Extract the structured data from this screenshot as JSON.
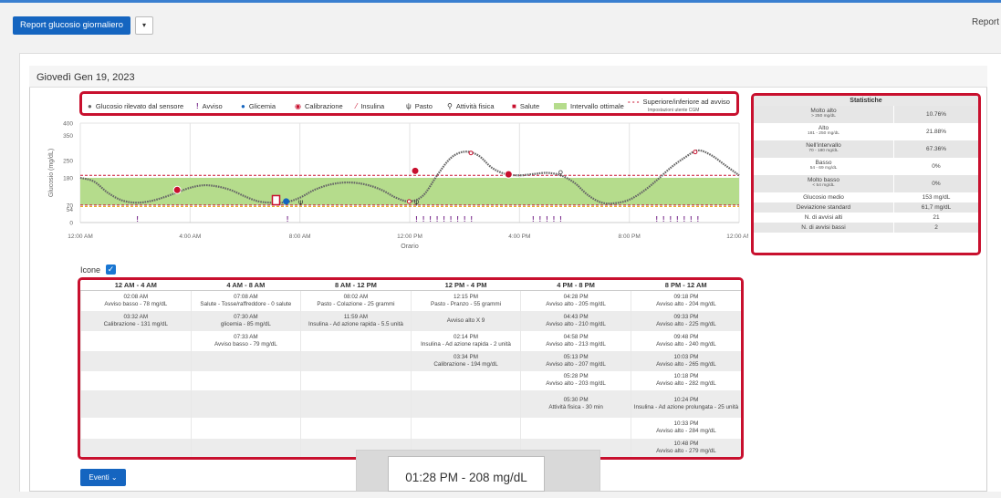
{
  "header": {
    "report_button": "Report glucosio giornaliero",
    "dropdown_caret": "▾",
    "report_right": "Report"
  },
  "date_title": "Giovedì Gen 19, 2023",
  "legend": {
    "sensor": "Glucosio rilevato dal sensore",
    "alert": "Avviso",
    "bg": "Glicemia",
    "calibration": "Calibrazione",
    "insulin": "Insulina",
    "meal": "Pasto",
    "exercise": "Attività fisica",
    "health": "Salute",
    "range": "Intervallo ottimale",
    "limits": "Superiore/inferiore ad avviso",
    "limits_sub": "Impostazioni utente CGM"
  },
  "colors": {
    "range_fill": "#b5dc8c",
    "limit_line": "#c8102e",
    "alert": "#7a2c8c",
    "highlight_border": "#c8102e",
    "primary": "#1565c0"
  },
  "stats": {
    "title": "Statistiche",
    "rows": [
      {
        "label": "Molto alto",
        "sub": "> 250 mg/dL",
        "value": "10.76%"
      },
      {
        "label": "Alto",
        "sub": "181 - 250 mg/dL",
        "value": "21.88%"
      },
      {
        "label": "Nell'intervallo",
        "sub": "70 - 180 mg/dL",
        "value": "67.36%"
      },
      {
        "label": "Basso",
        "sub": "54 - 69 mg/dL",
        "value": "0%"
      },
      {
        "label": "Molto basso",
        "sub": "< 54 mg/dL",
        "value": "0%"
      },
      {
        "label": "Glucosio medio",
        "sub": "",
        "value": "153 mg/dL"
      },
      {
        "label": "Deviazione standard",
        "sub": "",
        "value": "61,7 mg/dL"
      },
      {
        "label": "N. di avvisi alti",
        "sub": "",
        "value": "21"
      },
      {
        "label": "N. di avvisi bassi",
        "sub": "",
        "value": "2"
      }
    ]
  },
  "chart_data": {
    "type": "line",
    "ylabel": "Glucosio (mg/dL)",
    "xlabel": "Orario",
    "ylim": [
      0,
      400
    ],
    "yticks": [
      0,
      54,
      70,
      180,
      250,
      350,
      400
    ],
    "xticks": [
      "12:00 AM",
      "4:00 AM",
      "8:00 AM",
      "12:00 PM",
      "4:00 PM",
      "8:00 PM",
      "12:00 AM"
    ],
    "target_range": [
      70,
      180
    ],
    "alert_limits": [
      70,
      190
    ],
    "series": [
      {
        "x": [
          0,
          0.5,
          1,
          1.5,
          2,
          2.5,
          3,
          3.5,
          4,
          4.5,
          5,
          5.5,
          6,
          6.5,
          7,
          7.5,
          8,
          8.5,
          9,
          9.5,
          10,
          10.5,
          11,
          11.5,
          12,
          12.5,
          13,
          13.5,
          14,
          14.5,
          15,
          15.5,
          16,
          16.5,
          17,
          17.5,
          18,
          18.5,
          19,
          19.5,
          20,
          20.5,
          21,
          21.5,
          22,
          22.5,
          23,
          23.5,
          24
        ],
        "y": [
          180,
          165,
          120,
          90,
          80,
          85,
          100,
          120,
          140,
          150,
          145,
          130,
          105,
          85,
          80,
          82,
          100,
          130,
          150,
          160,
          160,
          150,
          130,
          100,
          85,
          110,
          190,
          260,
          285,
          270,
          220,
          195,
          190,
          195,
          200,
          190,
          160,
          110,
          80,
          78,
          92,
          125,
          170,
          220,
          260,
          290,
          270,
          230,
          190
        ]
      }
    ],
    "markers": {
      "alerts": [
        2.08,
        7.55,
        12.25,
        12.5,
        12.75,
        13.0,
        13.25,
        13.5,
        13.75,
        14.0,
        14.25,
        16.5,
        16.75,
        17.0,
        17.25,
        17.5,
        21.0,
        21.25,
        21.5,
        21.75,
        22.0,
        22.25,
        22.5
      ],
      "calibration": [
        {
          "x": 3.53,
          "y": 131
        },
        {
          "x": 12.2,
          "y": 208
        },
        {
          "x": 15.6,
          "y": 194
        }
      ],
      "bg": [
        {
          "x": 7.5,
          "y": 85
        }
      ],
      "meal": [
        {
          "x": 8.03,
          "y": 85
        },
        {
          "x": 12.25,
          "y": 85
        }
      ],
      "health": [
        {
          "x": 7.13,
          "y": 90
        }
      ],
      "exercise": [
        {
          "x": 17.5,
          "y": 200
        }
      ],
      "insulin": [
        {
          "x": 11.98,
          "y": 85
        },
        {
          "x": 14.23,
          "y": 280
        },
        {
          "x": 22.4,
          "y": 284
        }
      ]
    }
  },
  "icone": {
    "label": "Icone",
    "checked": "✓"
  },
  "events": {
    "headers": [
      "12 AM - 4 AM",
      "4 AM - 8 AM",
      "8 AM - 12 PM",
      "12 PM - 4 PM",
      "4 PM - 8 PM",
      "8 PM - 12 AM"
    ],
    "rows": [
      [
        [
          "02:08 AM",
          "Avviso basso - 78 mg/dL"
        ],
        [
          "07:08 AM",
          "Salute - Tosse/raffreddore - 0 salute"
        ],
        [
          "08:02 AM",
          "Pasto - Colazione - 25 grammi"
        ],
        [
          "12:15 PM",
          "Pasto - Pranzo - 55 grammi"
        ],
        [
          "04:28 PM",
          "Avviso alto - 205 mg/dL"
        ],
        [
          "09:18 PM",
          "Avviso alto - 204 mg/dL"
        ]
      ],
      [
        [
          "03:32 AM",
          "Calibrazione - 131 mg/dL"
        ],
        [
          "07:30 AM",
          "glicemia - 85 mg/dL"
        ],
        [
          "11:59 AM",
          "Insulina - Ad azione rapida - 5.5 unità"
        ],
        [
          "",
          "Avviso alto X 9"
        ],
        [
          "04:43 PM",
          "Avviso alto - 210 mg/dL"
        ],
        [
          "09:33 PM",
          "Avviso alto - 225 mg/dL"
        ]
      ],
      [
        [
          "",
          ""
        ],
        [
          "07:33 AM",
          "Avviso basso - 79 mg/dL"
        ],
        [
          "",
          ""
        ],
        [
          "02:14 PM",
          "Insulina - Ad azione rapida - 2 unità"
        ],
        [
          "04:58 PM",
          "Avviso alto - 213 mg/dL"
        ],
        [
          "09:48 PM",
          "Avviso alto - 240 mg/dL"
        ]
      ],
      [
        [
          "",
          ""
        ],
        [
          "",
          ""
        ],
        [
          "",
          ""
        ],
        [
          "03:34 PM",
          "Calibrazione - 194 mg/dL"
        ],
        [
          "05:13 PM",
          "Avviso alto - 207 mg/dL"
        ],
        [
          "10:03 PM",
          "Avviso alto - 265 mg/dL"
        ]
      ],
      [
        [
          "",
          ""
        ],
        [
          "",
          ""
        ],
        [
          "",
          ""
        ],
        [
          "",
          ""
        ],
        [
          "05:28 PM",
          "Avviso alto - 203 mg/dL"
        ],
        [
          "10:18 PM",
          "Avviso alto - 282 mg/dL"
        ]
      ],
      [
        [
          "",
          ""
        ],
        [
          "",
          ""
        ],
        [
          "",
          ""
        ],
        [
          "",
          ""
        ],
        [
          "05:30 PM",
          "Attività fisica - 30 min"
        ],
        [
          "10:24 PM",
          "Insulina - Ad azione prolungata - 25 unità"
        ]
      ],
      [
        [
          "",
          ""
        ],
        [
          "",
          ""
        ],
        [
          "",
          ""
        ],
        [
          "",
          ""
        ],
        [
          "",
          ""
        ],
        [
          "10:33 PM",
          "Avviso alto - 284 mg/dL"
        ]
      ],
      [
        [
          "",
          ""
        ],
        [
          "",
          ""
        ],
        [
          "",
          ""
        ],
        [
          "",
          ""
        ],
        [
          "",
          ""
        ],
        [
          "10:48 PM",
          "Avviso alto - 279 mg/dL"
        ]
      ]
    ]
  },
  "eventi_button": "Eventi",
  "eventi_caret": "⌄",
  "tooltip": "01:28 PM - 208 mg/dL"
}
